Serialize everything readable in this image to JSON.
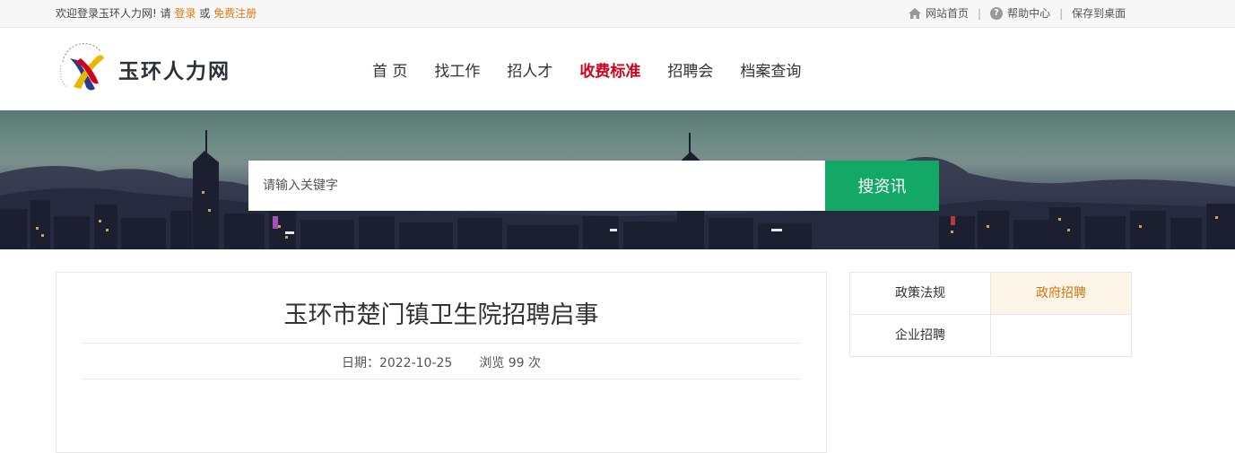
{
  "topbar": {
    "welcome": "欢迎登录玉环人力网!  请 ",
    "login": "登录",
    "or": " 或 ",
    "register": "免费注册",
    "links": [
      "网站首页",
      "帮助中心",
      "保存到桌面"
    ],
    "separator": "|",
    "help_glyph": "?"
  },
  "logo": {
    "text": "玉环人力网",
    "icon": "logo-mark"
  },
  "nav": {
    "items": [
      "首 页",
      "找工作",
      "招人才",
      "收费标准",
      "招聘会",
      "档案查询"
    ],
    "active": "收费标准"
  },
  "search": {
    "placeholder": "请输入关键字",
    "value": "",
    "button": "搜资讯"
  },
  "article": {
    "title": "玉环市楚门镇卫生院招聘启事",
    "date_label": "日期：2022-10-25",
    "views_label": "浏览 99 次"
  },
  "sidebar": {
    "items": [
      "政策法规",
      "政府招聘",
      "企业招聘"
    ],
    "active": "政府招聘"
  },
  "colors": {
    "accent_red": "#d0021b",
    "link_orange": "#e07a10",
    "search_green": "#14a866",
    "side_active": "#d9730d"
  }
}
